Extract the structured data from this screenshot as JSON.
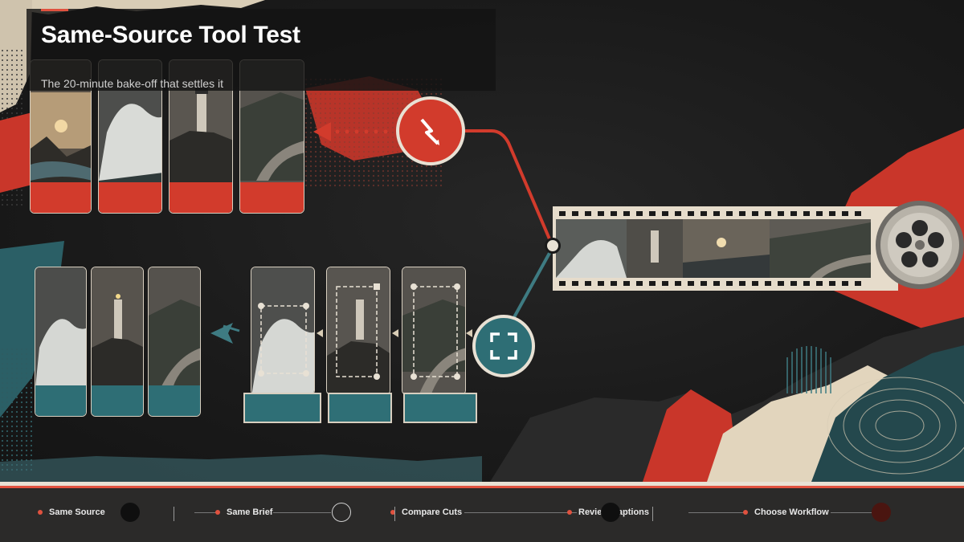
{
  "slide": {
    "title": "Same-Source Tool Test",
    "subtitle": "The 20-minute bake-off that settles it"
  },
  "colors": {
    "accent_red": "#d23b2c",
    "accent_teal": "#2e6e75",
    "cream": "#e8e1d4",
    "dark": "#1a1a1a"
  },
  "icons": {
    "flash_badge": "lightning-bolt-icon",
    "crop_badge": "crop-frame-icon",
    "film_reel": "film-reel-icon",
    "film_strip": "film-strip-icon"
  },
  "steps": [
    {
      "label": "Same Source"
    },
    {
      "label": "Same Brief"
    },
    {
      "label": "Compare Cuts"
    },
    {
      "label": "Review Captions"
    },
    {
      "label": "Choose Workflow"
    }
  ]
}
